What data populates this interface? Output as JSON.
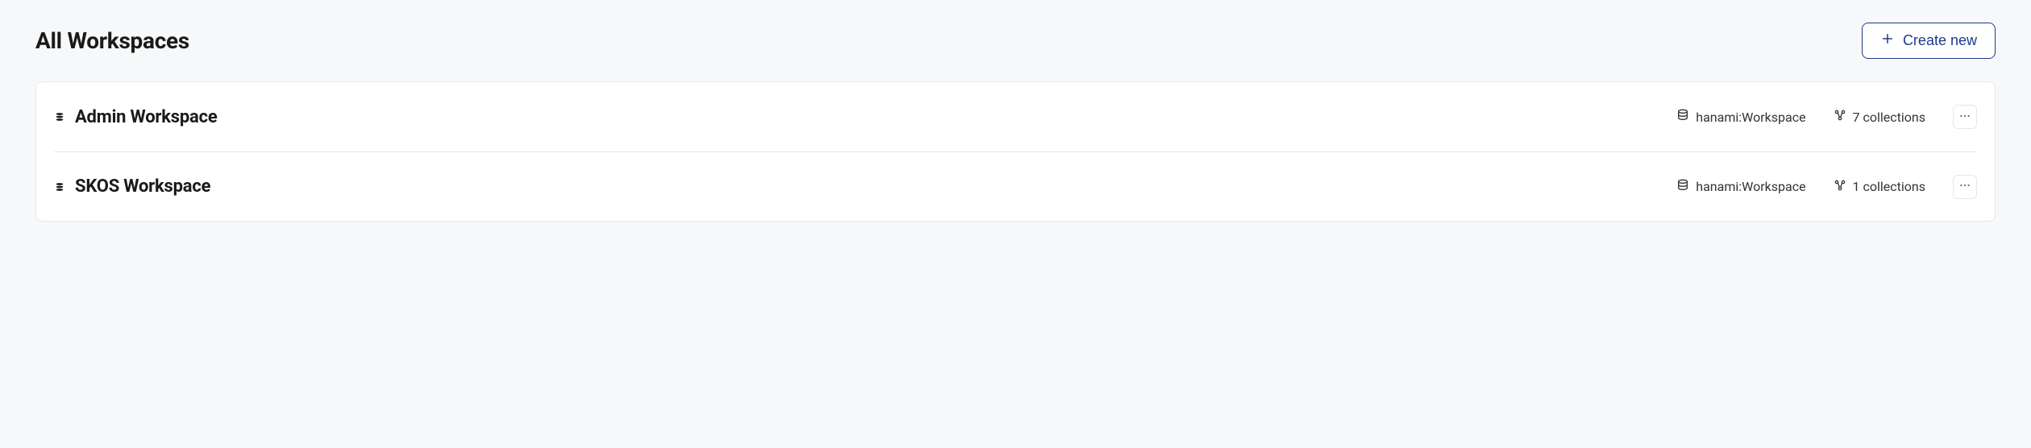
{
  "header": {
    "title": "All Workspaces",
    "create_label": "Create new"
  },
  "workspaces": [
    {
      "name": "Admin Workspace",
      "db_label": "hanami:Workspace",
      "collections_label": "7 collections"
    },
    {
      "name": "SKOS Workspace",
      "db_label": "hanami:Workspace",
      "collections_label": "1 collections"
    }
  ]
}
